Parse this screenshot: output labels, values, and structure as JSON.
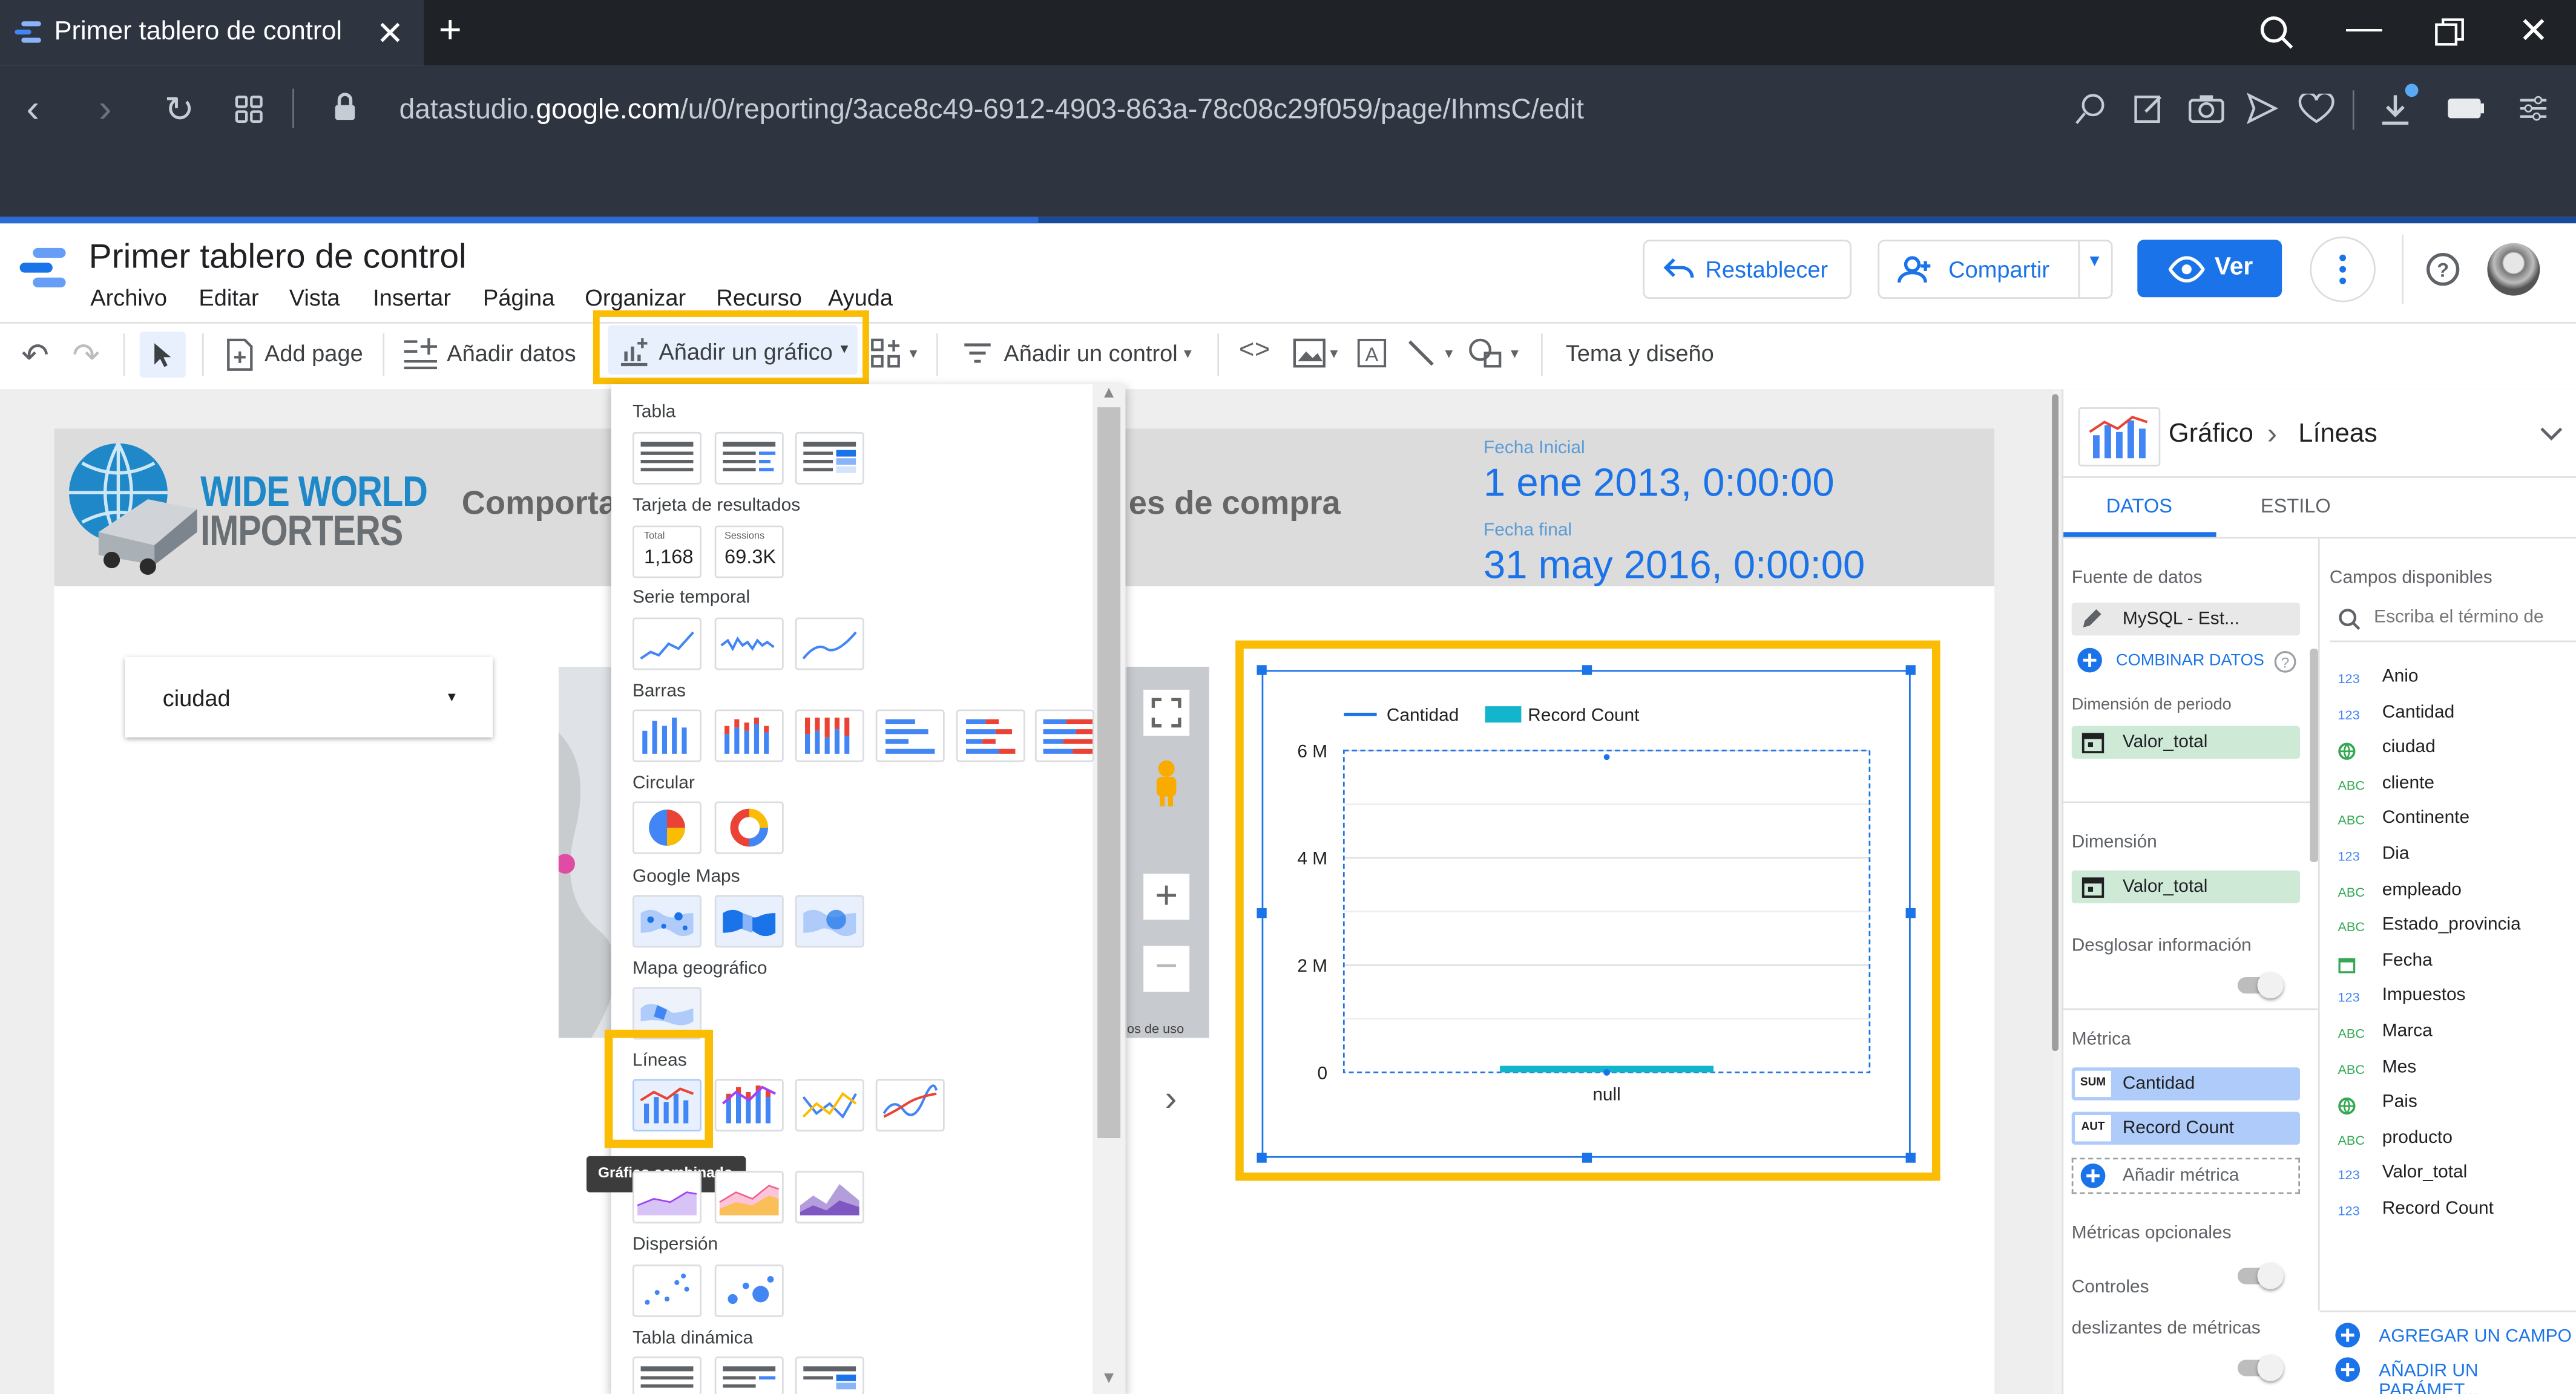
{
  "browser": {
    "tab_title": "Primer tablero de control",
    "url_prefix": "datastudio.",
    "url_domain": "google.com",
    "url_path": "/u/0/reporting/3ace8c49-6912-4903-863a-78c08c29f059/page/IhmsC/edit"
  },
  "app": {
    "doc_title": "Primer tablero de control",
    "menu": [
      "Archivo",
      "Editar",
      "Vista",
      "Insertar",
      "Página",
      "Organizar",
      "Recurso",
      "Ayuda"
    ],
    "reset_label": "Restablecer",
    "share_label": "Compartir",
    "view_label": "Ver"
  },
  "toolbar": {
    "add_page": "Add page",
    "add_data": "Añadir datos",
    "add_chart": "Añadir un gráfico",
    "add_control": "Añadir un control",
    "theme": "Tema y diseño"
  },
  "report": {
    "logo_line1": "WIDE WORLD",
    "logo_line2": "IMPORTERS",
    "title_part1": "Comportar",
    "title_part2": "es de compra",
    "start_label": "Fecha Inicial",
    "start_value": "1 ene 2013, 0:00:00",
    "end_label": "Fecha final",
    "end_value": "31 may 2016, 0:00:00",
    "filter_label": "ciudad",
    "map_terms": "os de uso"
  },
  "chart_menu": {
    "sections": [
      "Tabla",
      "Tarjeta de resultados",
      "Serie temporal",
      "Barras",
      "Circular",
      "Google Maps",
      "Mapa geográfico",
      "Líneas",
      "Dispersión",
      "Tabla dinámica"
    ],
    "scorecard_1_label": "Total",
    "scorecard_1_value": "1,168",
    "scorecard_2_label": "Sessions",
    "scorecard_2_value": "69.3K",
    "tooltip": "Gráfico combinado"
  },
  "chart_data": {
    "type": "bar",
    "categories": [
      "null"
    ],
    "series": [
      {
        "name": "Cantidad",
        "type": "line",
        "values": [
          0
        ],
        "color": "#1a73e8"
      },
      {
        "name": "Record Count",
        "type": "bar",
        "values": [
          0
        ],
        "color": "#12b5cb"
      }
    ],
    "ylim": [
      0,
      6000000
    ],
    "yticks": [
      "0",
      "2 M",
      "4 M",
      "6 M"
    ],
    "legend": "top-left",
    "grid": true
  },
  "panel": {
    "breadcrumb_1": "Gráfico",
    "breadcrumb_2": "Líneas",
    "tab_data": "DATOS",
    "tab_style": "ESTILO",
    "datasource_label": "Fuente de datos",
    "datasource_value": "MySQL - Est...",
    "blend": "COMBINAR DATOS",
    "period_label": "Dimensión de periodo",
    "period_value": "Valor_total",
    "dimension_label": "Dimensión",
    "dimension_value": "Valor_total",
    "drill_label": "Desglosar información",
    "metric_label": "Métrica",
    "metric_1_agg": "SUM",
    "metric_1": "Cantidad",
    "metric_2_agg": "AUT",
    "metric_2": "Record Count",
    "add_metric": "Añadir métrica",
    "optional_metrics": "Métricas opcionales",
    "sliders_1": "Controles",
    "sliders_2": "deslizantes de métricas",
    "available_label": "Campos disponibles",
    "search_placeholder": "Escriba el término de",
    "fields": [
      {
        "type": "123",
        "name": "Anio"
      },
      {
        "type": "123",
        "name": "Cantidad"
      },
      {
        "type": "geo",
        "name": "ciudad"
      },
      {
        "type": "ABC",
        "name": "cliente"
      },
      {
        "type": "ABC",
        "name": "Continente"
      },
      {
        "type": "123",
        "name": "Dia"
      },
      {
        "type": "ABC",
        "name": "empleado"
      },
      {
        "type": "ABC",
        "name": "Estado_provincia"
      },
      {
        "type": "date",
        "name": "Fecha"
      },
      {
        "type": "123",
        "name": "Impuestos"
      },
      {
        "type": "ABC",
        "name": "Marca"
      },
      {
        "type": "ABC",
        "name": "Mes"
      },
      {
        "type": "geo",
        "name": "Pais"
      },
      {
        "type": "ABC",
        "name": "producto"
      },
      {
        "type": "123",
        "name": "Valor_total"
      },
      {
        "type": "123",
        "name": "Record Count"
      }
    ],
    "add_field": "AGREGAR UN CAMPO",
    "add_param": "AÑADIR UN PARÁMET..."
  },
  "colors": {
    "accent": "#1a73e8",
    "highlight": "#fbbc04",
    "chip_green": "#ceead6",
    "chip_blue": "#aecbfa",
    "record_bar": "#12b5cb"
  }
}
